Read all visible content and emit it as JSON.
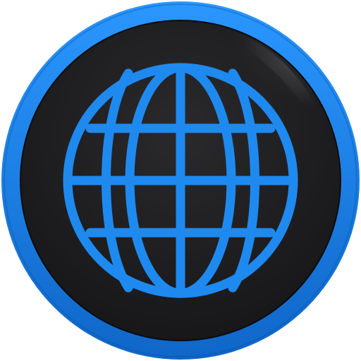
{
  "app_icon": {
    "icon": "globe-icon",
    "colors": {
      "ring": "#1b87ef",
      "ring_dark": "#0f66c8",
      "disc": "#1e1e20",
      "disc_top": "#2e2e31",
      "globe_lines": "#1e8af0",
      "highlight": "#ffffff",
      "background": "#ffffff"
    }
  }
}
